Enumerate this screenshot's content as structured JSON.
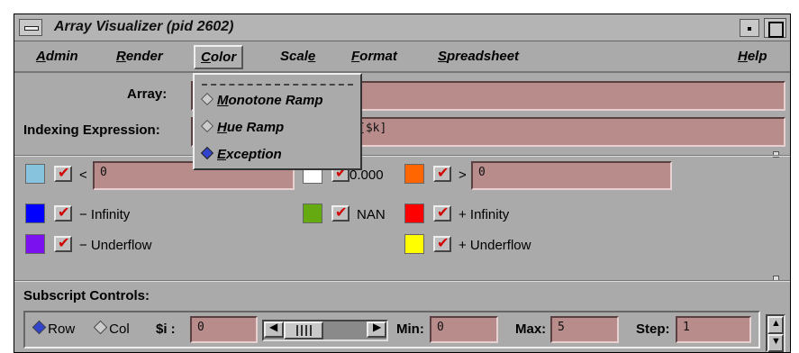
{
  "window": {
    "title": "Array Visualizer (pid 2602)"
  },
  "menubar": {
    "admin": "dmin",
    "admin_u": "A",
    "render": "ender",
    "render_u": "R",
    "color": "olor",
    "color_u": "C",
    "scale": "Scal",
    "scale_u": "e",
    "format": "ormat",
    "format_u": "F",
    "spreadsheet": "preadsheet",
    "spreadsheet_u": "S",
    "help": "elp",
    "help_u": "H"
  },
  "color_menu": {
    "items": [
      {
        "u": "M",
        "rest": "onotone Ramp",
        "selected": false
      },
      {
        "u": "H",
        "rest": "ue Ramp",
        "selected": false
      },
      {
        "u": "E",
        "rest": "xception",
        "selected": true
      }
    ]
  },
  "form": {
    "array_label": "Array:",
    "array_value": "",
    "indexing_label": "Indexing Expression:",
    "indexing_value": "[$k]"
  },
  "exceptions": {
    "less_sign": "<",
    "less_value": "0",
    "equal_value": "0.000",
    "greater_sign": ">",
    "greater_value": "0",
    "neg_inf": "− Infinity",
    "nan": "NAN",
    "pos_inf": "+ Infinity",
    "neg_under": "− Underflow",
    "pos_under": "+ Underflow",
    "colors": {
      "less": "#87c3dd",
      "equal": "#ffffff",
      "greater": "#ff6600",
      "neg_inf": "#0000ff",
      "nan": "#66aa11",
      "pos_inf": "#ff0000",
      "neg_under": "#7a11ee",
      "pos_under": "#ffff00"
    }
  },
  "subscript": {
    "header": "Subscript Controls:",
    "row_label": "Row",
    "col_label": "Col",
    "var_label": "$i :",
    "var_value": "0",
    "min_label": "Min:",
    "min_value": "0",
    "max_label": "Max:",
    "max_value": "5",
    "step_label": "Step:",
    "step_value": "1"
  }
}
